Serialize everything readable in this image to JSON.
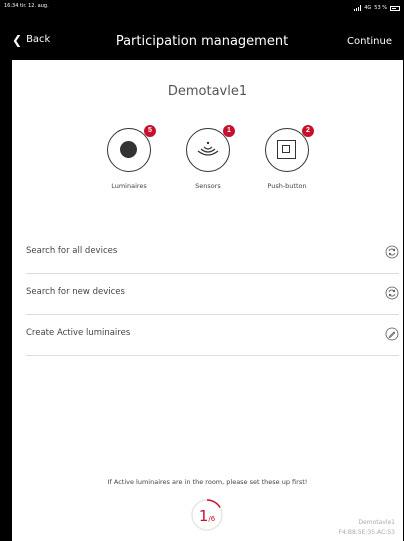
{
  "status_bar": {
    "time_date": "16:34 tir. 12. aug.",
    "network": "4G",
    "battery": "53 %"
  },
  "nav": {
    "back_label": "Back",
    "title": "Participation management",
    "continue_label": "Continue"
  },
  "device_name": "Demotavle1",
  "tiles": [
    {
      "label": "Luminaires",
      "badge": "5",
      "icon": "luminaire-icon"
    },
    {
      "label": "Sensors",
      "badge": "1",
      "icon": "sensor-icon"
    },
    {
      "label": "Push-button",
      "badge": "2",
      "icon": "push-button-icon"
    }
  ],
  "actions": [
    {
      "label": "Search for all devices",
      "icon": "refresh-icon"
    },
    {
      "label": "Search for new devices",
      "icon": "refresh-icon"
    },
    {
      "label": "Create Active luminaires",
      "icon": "pencil-icon"
    }
  ],
  "hint": "If Active luminaires are in the room, please set these up first!",
  "progress": {
    "current": "1",
    "total": "/6",
    "fraction": 0.1667
  },
  "footer": {
    "device_name": "Demotavle1",
    "mac_address": "F4:B8:5E:35:AC:53"
  },
  "colors": {
    "accent": "#c8102e",
    "header": "#000000"
  }
}
